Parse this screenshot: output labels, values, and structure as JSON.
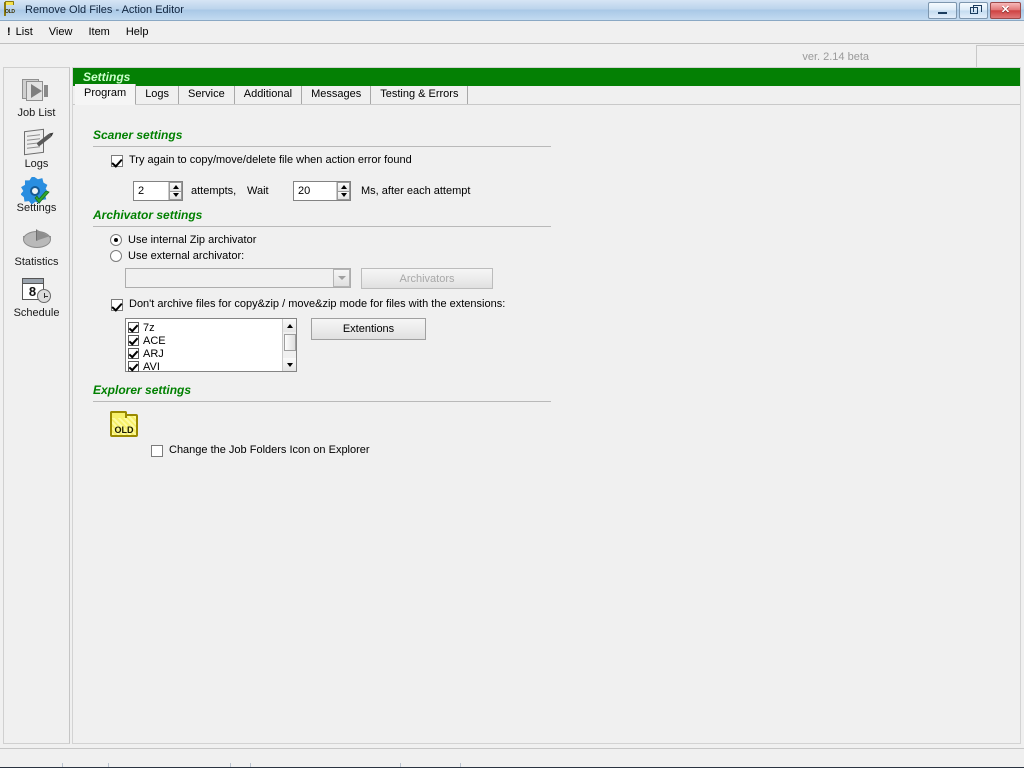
{
  "window": {
    "title": "Remove Old Files - Action Editor",
    "app_icon": "old-folder-icon",
    "minimize_label": "Minimize",
    "maximize_label": "Restore",
    "close_label": "Close",
    "close_glyph": "✕"
  },
  "menubar": {
    "bang": "!",
    "items": [
      {
        "label": "List"
      },
      {
        "label": "View"
      },
      {
        "label": "Item"
      },
      {
        "label": "Help"
      }
    ]
  },
  "version": "ver. 2.14 beta",
  "sidebar": {
    "items": [
      {
        "label": "Job List",
        "icon": "joblist-icon",
        "selected": false
      },
      {
        "label": "Logs",
        "icon": "logs-icon",
        "selected": false
      },
      {
        "label": "Settings",
        "icon": "settings-gear-check-icon",
        "selected": true
      },
      {
        "label": "Statistics",
        "icon": "pie-chart-icon",
        "selected": false
      },
      {
        "label": "Schedule",
        "icon": "calendar-clock-icon",
        "selected": false
      }
    ],
    "schedule_day": "8"
  },
  "panel": {
    "header": "Settings",
    "header_bg": "#048004",
    "header_fg": "#ccffcc",
    "tabs": [
      {
        "label": "Program",
        "active": true
      },
      {
        "label": "Logs",
        "active": false
      },
      {
        "label": "Service",
        "active": false
      },
      {
        "label": "Additional",
        "active": false
      },
      {
        "label": "Messages",
        "active": false
      },
      {
        "label": "Testing & Errors",
        "active": false
      }
    ]
  },
  "scaner_settings": {
    "title": "Scaner settings",
    "retry_checkbox": {
      "label": "Try again to copy/move/delete file when action error found",
      "checked": true
    },
    "attempts": {
      "value": "2",
      "label": "attempts,"
    },
    "wait_label": "Wait",
    "wait": {
      "value": "20"
    },
    "ms_label": "Ms, after each attempt"
  },
  "archivator_settings": {
    "title": "Archivator settings",
    "internal_radio": {
      "label": "Use internal Zip archivator",
      "selected": true
    },
    "external_radio": {
      "label": "Use external archivator:",
      "selected": false
    },
    "archivator_combo": {
      "value": "",
      "enabled": false
    },
    "archivators_button": {
      "label": "Archivators",
      "enabled": false
    },
    "dont_archive_checkbox": {
      "label": "Don't archive files for copy&zip / move&zip mode for files with the extensions:",
      "checked": true
    },
    "extensions_list": [
      {
        "label": "7z",
        "checked": true
      },
      {
        "label": "ACE",
        "checked": true
      },
      {
        "label": "ARJ",
        "checked": true
      },
      {
        "label": "AVI",
        "checked": true
      }
    ],
    "extensions_button": {
      "label": "Extentions"
    }
  },
  "explorer_settings": {
    "title": "Explorer settings",
    "folder_icon_label": "OLD",
    "change_icon_checkbox": {
      "label": "Change the Job Folders Icon on Explorer",
      "checked": false
    }
  },
  "colors": {
    "group_title": "#008000",
    "header_green": "#048004",
    "titlebar_blue": "#a9c8e6",
    "folder_yellow": "#f5e14b"
  }
}
